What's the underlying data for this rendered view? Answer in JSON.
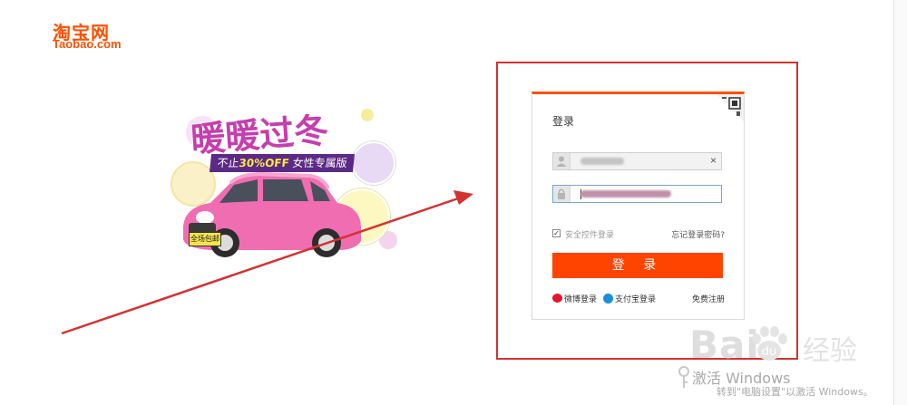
{
  "header": {
    "logo_cn": "淘宝网",
    "logo_en": "Taobao.com"
  },
  "promo": {
    "title": "暖暖过冬",
    "banner_prefix": "不止",
    "banner_highlight": "30%OFF",
    "banner_suffix": " 女性专属版",
    "plate": "全场包邮"
  },
  "login": {
    "title": "登录",
    "security_checkbox_label": "安全控件登录",
    "security_checked": true,
    "forgot_link": "忘记登录密码?",
    "submit_label": "登 录",
    "weibo_label": "微博登录",
    "alipay_label": "支付宝登录",
    "signup_label": "免费注册",
    "clear_glyph": "×"
  },
  "watermark": {
    "baidu_bai": "Bai",
    "baidu_du": "du",
    "baidu_jy": "经验",
    "win_line1": "激活 Windows",
    "win_line2": "转到\"电脑设置\"以激活 Windows。"
  },
  "colors": {
    "brand": "#ff5000",
    "button": "#ff4400",
    "annotation": "#d23232"
  }
}
